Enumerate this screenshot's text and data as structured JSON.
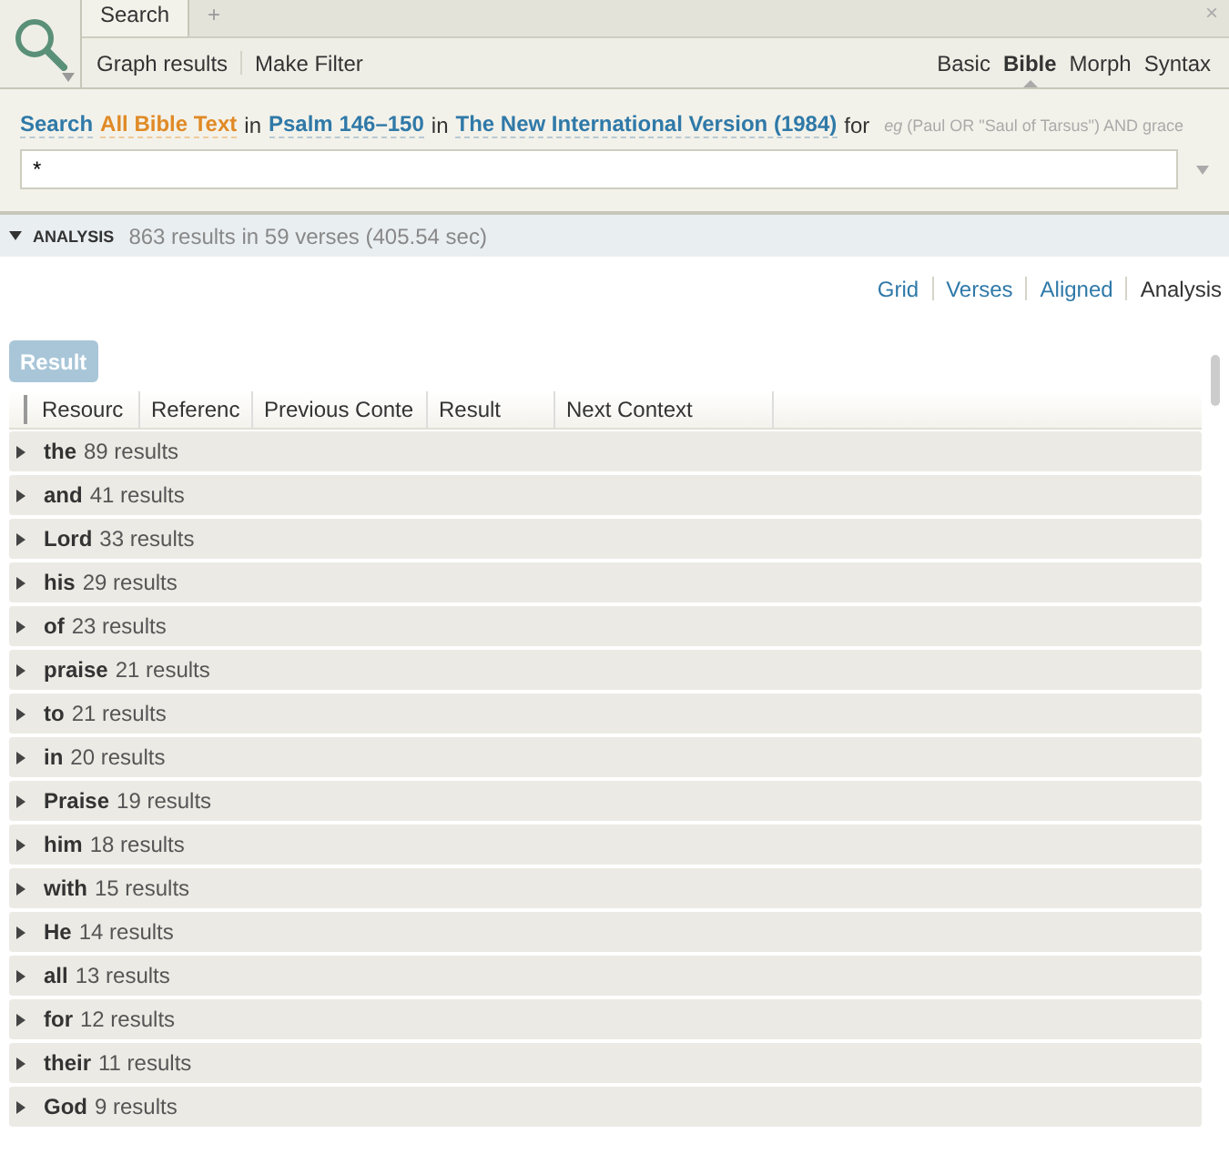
{
  "tabs": [
    {
      "label": "Search",
      "selected": true
    },
    {
      "label": "+",
      "selected": false
    }
  ],
  "close_glyph": "×",
  "toolbar": {
    "actions": [
      "Graph results",
      "Make Filter"
    ],
    "modes": [
      {
        "label": "Basic",
        "selected": false
      },
      {
        "label": "Bible",
        "selected": true
      },
      {
        "label": "Morph",
        "selected": false
      },
      {
        "label": "Syntax",
        "selected": false
      }
    ]
  },
  "query_line": [
    {
      "text": "Search",
      "kind": "link"
    },
    {
      "text": "All Bible Text",
      "kind": "accent"
    },
    {
      "text": "in",
      "kind": "plain"
    },
    {
      "text": "Psalm 146–150",
      "kind": "link"
    },
    {
      "text": "in",
      "kind": "plain"
    },
    {
      "text": "The New International Version (1984)",
      "kind": "link"
    },
    {
      "text": "for",
      "kind": "plain"
    }
  ],
  "hint": "*eg* (Paul OR \"Saul of Tarsus\") AND grace",
  "query": "*",
  "analysis": {
    "title": "ANALYSIS",
    "expanded": true,
    "summary": "863 results in 59 verses (405.54 sec)"
  },
  "views": [
    {
      "label": "Grid",
      "selected": false
    },
    {
      "label": "Verses",
      "selected": false
    },
    {
      "label": "Aligned",
      "selected": false
    },
    {
      "label": "Analysis",
      "selected": true
    }
  ],
  "group_button": "Result",
  "columns": [
    "Resourc",
    "Referenc",
    "Previous Conte",
    "Result",
    "Next Context"
  ],
  "rows": [
    {
      "word": "the",
      "count": "89 results"
    },
    {
      "word": "and",
      "count": "41 results"
    },
    {
      "word": "Lord",
      "count": "33 results"
    },
    {
      "word": "his",
      "count": "29 results"
    },
    {
      "word": "of",
      "count": "23 results"
    },
    {
      "word": "praise",
      "count": "21 results"
    },
    {
      "word": "to",
      "count": "21 results"
    },
    {
      "word": "in",
      "count": "20 results"
    },
    {
      "word": "Praise",
      "count": "19 results"
    },
    {
      "word": "him",
      "count": "18 results"
    },
    {
      "word": "with",
      "count": "15 results"
    },
    {
      "word": "He",
      "count": "14 results"
    },
    {
      "word": "all",
      "count": "13 results"
    },
    {
      "word": "for",
      "count": "12 results"
    },
    {
      "word": "their",
      "count": "11 results"
    },
    {
      "word": "God",
      "count": "9 results"
    }
  ]
}
